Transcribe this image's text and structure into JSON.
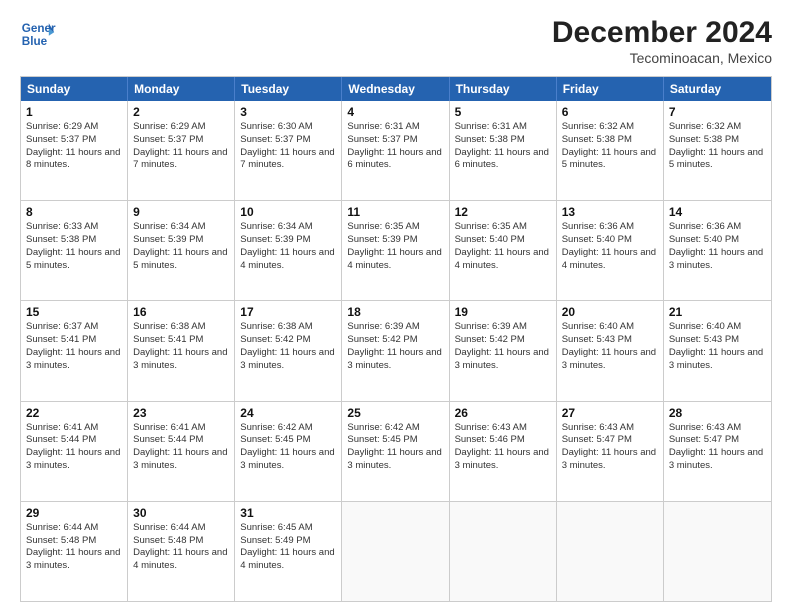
{
  "header": {
    "logo_line1": "General",
    "logo_line2": "Blue",
    "title": "December 2024",
    "subtitle": "Tecominoacan, Mexico"
  },
  "days": [
    "Sunday",
    "Monday",
    "Tuesday",
    "Wednesday",
    "Thursday",
    "Friday",
    "Saturday"
  ],
  "weeks": [
    [
      {
        "day": "1",
        "sunrise": "6:29 AM",
        "sunset": "5:37 PM",
        "daylight": "11 hours and 8 minutes."
      },
      {
        "day": "2",
        "sunrise": "6:29 AM",
        "sunset": "5:37 PM",
        "daylight": "11 hours and 7 minutes."
      },
      {
        "day": "3",
        "sunrise": "6:30 AM",
        "sunset": "5:37 PM",
        "daylight": "11 hours and 7 minutes."
      },
      {
        "day": "4",
        "sunrise": "6:31 AM",
        "sunset": "5:37 PM",
        "daylight": "11 hours and 6 minutes."
      },
      {
        "day": "5",
        "sunrise": "6:31 AM",
        "sunset": "5:38 PM",
        "daylight": "11 hours and 6 minutes."
      },
      {
        "day": "6",
        "sunrise": "6:32 AM",
        "sunset": "5:38 PM",
        "daylight": "11 hours and 5 minutes."
      },
      {
        "day": "7",
        "sunrise": "6:32 AM",
        "sunset": "5:38 PM",
        "daylight": "11 hours and 5 minutes."
      }
    ],
    [
      {
        "day": "8",
        "sunrise": "6:33 AM",
        "sunset": "5:38 PM",
        "daylight": "11 hours and 5 minutes."
      },
      {
        "day": "9",
        "sunrise": "6:34 AM",
        "sunset": "5:39 PM",
        "daylight": "11 hours and 5 minutes."
      },
      {
        "day": "10",
        "sunrise": "6:34 AM",
        "sunset": "5:39 PM",
        "daylight": "11 hours and 4 minutes."
      },
      {
        "day": "11",
        "sunrise": "6:35 AM",
        "sunset": "5:39 PM",
        "daylight": "11 hours and 4 minutes."
      },
      {
        "day": "12",
        "sunrise": "6:35 AM",
        "sunset": "5:40 PM",
        "daylight": "11 hours and 4 minutes."
      },
      {
        "day": "13",
        "sunrise": "6:36 AM",
        "sunset": "5:40 PM",
        "daylight": "11 hours and 4 minutes."
      },
      {
        "day": "14",
        "sunrise": "6:36 AM",
        "sunset": "5:40 PM",
        "daylight": "11 hours and 3 minutes."
      }
    ],
    [
      {
        "day": "15",
        "sunrise": "6:37 AM",
        "sunset": "5:41 PM",
        "daylight": "11 hours and 3 minutes."
      },
      {
        "day": "16",
        "sunrise": "6:38 AM",
        "sunset": "5:41 PM",
        "daylight": "11 hours and 3 minutes."
      },
      {
        "day": "17",
        "sunrise": "6:38 AM",
        "sunset": "5:42 PM",
        "daylight": "11 hours and 3 minutes."
      },
      {
        "day": "18",
        "sunrise": "6:39 AM",
        "sunset": "5:42 PM",
        "daylight": "11 hours and 3 minutes."
      },
      {
        "day": "19",
        "sunrise": "6:39 AM",
        "sunset": "5:42 PM",
        "daylight": "11 hours and 3 minutes."
      },
      {
        "day": "20",
        "sunrise": "6:40 AM",
        "sunset": "5:43 PM",
        "daylight": "11 hours and 3 minutes."
      },
      {
        "day": "21",
        "sunrise": "6:40 AM",
        "sunset": "5:43 PM",
        "daylight": "11 hours and 3 minutes."
      }
    ],
    [
      {
        "day": "22",
        "sunrise": "6:41 AM",
        "sunset": "5:44 PM",
        "daylight": "11 hours and 3 minutes."
      },
      {
        "day": "23",
        "sunrise": "6:41 AM",
        "sunset": "5:44 PM",
        "daylight": "11 hours and 3 minutes."
      },
      {
        "day": "24",
        "sunrise": "6:42 AM",
        "sunset": "5:45 PM",
        "daylight": "11 hours and 3 minutes."
      },
      {
        "day": "25",
        "sunrise": "6:42 AM",
        "sunset": "5:45 PM",
        "daylight": "11 hours and 3 minutes."
      },
      {
        "day": "26",
        "sunrise": "6:43 AM",
        "sunset": "5:46 PM",
        "daylight": "11 hours and 3 minutes."
      },
      {
        "day": "27",
        "sunrise": "6:43 AM",
        "sunset": "5:47 PM",
        "daylight": "11 hours and 3 minutes."
      },
      {
        "day": "28",
        "sunrise": "6:43 AM",
        "sunset": "5:47 PM",
        "daylight": "11 hours and 3 minutes."
      }
    ],
    [
      {
        "day": "29",
        "sunrise": "6:44 AM",
        "sunset": "5:48 PM",
        "daylight": "11 hours and 3 minutes."
      },
      {
        "day": "30",
        "sunrise": "6:44 AM",
        "sunset": "5:48 PM",
        "daylight": "11 hours and 4 minutes."
      },
      {
        "day": "31",
        "sunrise": "6:45 AM",
        "sunset": "5:49 PM",
        "daylight": "11 hours and 4 minutes."
      },
      null,
      null,
      null,
      null
    ]
  ]
}
